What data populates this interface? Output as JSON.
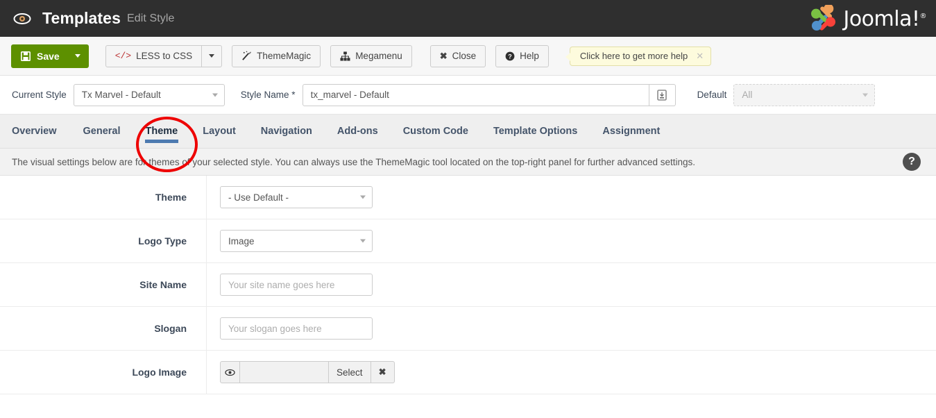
{
  "header": {
    "eye_icon": "eye-icon",
    "title": "Templates",
    "subtitle": "Edit Style",
    "brand": "Joomla!",
    "brand_reg": "®"
  },
  "toolbar": {
    "save_label": "Save",
    "save_icon": "floppy-disk-icon",
    "less_to_css_label": "LESS to CSS",
    "less_to_css_icon": "code-icon",
    "thememagic_label": "ThemeMagic",
    "thememagic_icon": "magic-wand-icon",
    "megamenu_label": "Megamenu",
    "megamenu_icon": "sitemap-icon",
    "close_label": "Close",
    "close_icon": "x-icon",
    "help_label": "Help",
    "help_icon": "question-circle-icon",
    "tooltip_text": "Click here to get more help",
    "tooltip_close": "✕"
  },
  "stylebar": {
    "current_style_label": "Current Style",
    "current_style_value": "Tx Marvel - Default",
    "style_name_label": "Style Name *",
    "style_name_value": "tx_marvel - Default",
    "style_name_addon_icon": "save-copy-icon",
    "default_label": "Default",
    "default_value": "All"
  },
  "tabs": [
    {
      "label": "Overview",
      "active": false
    },
    {
      "label": "General",
      "active": false
    },
    {
      "label": "Theme",
      "active": true
    },
    {
      "label": "Layout",
      "active": false
    },
    {
      "label": "Navigation",
      "active": false
    },
    {
      "label": "Add-ons",
      "active": false
    },
    {
      "label": "Custom Code",
      "active": false
    },
    {
      "label": "Template Options",
      "active": false
    },
    {
      "label": "Assignment",
      "active": false
    }
  ],
  "description": {
    "text": "The visual settings below are for themes of your selected style. You can always use the ThemeMagic tool located on the top-right panel for further advanced settings.",
    "help_icon": "question-mark-icon",
    "help_glyph": "?"
  },
  "form": {
    "theme": {
      "label": "Theme",
      "value": "- Use Default -"
    },
    "logo_type": {
      "label": "Logo Type",
      "value": "Image"
    },
    "site_name": {
      "label": "Site Name",
      "value": "",
      "placeholder": "Your site name goes here"
    },
    "slogan": {
      "label": "Slogan",
      "value": "",
      "placeholder": "Your slogan goes here"
    },
    "logo_image": {
      "label": "Logo Image",
      "value": "",
      "eye_icon": "eye-preview-icon",
      "select_label": "Select",
      "clear_icon": "x-clear-icon",
      "clear_glyph": "✖"
    }
  },
  "annotation": {
    "shape": "red-ellipse",
    "target": "Theme",
    "color": "#ee0000"
  },
  "colors": {
    "header_bg": "#2f2f2f",
    "toolbar_bg": "#f7f7f7",
    "save_green": "#5d9000",
    "tab_active_underline": "#4d7ab0",
    "tooltip_bg": "#fdfbdd",
    "annotation_red": "#ee0000"
  }
}
